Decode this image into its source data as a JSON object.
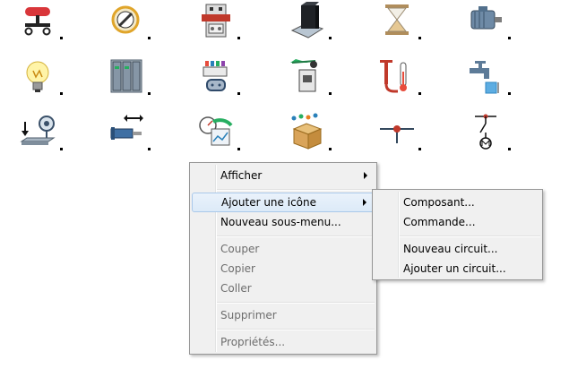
{
  "icons": [
    {
      "name": "red-button-icon"
    },
    {
      "name": "no-entry-icon"
    },
    {
      "name": "contactor-icon"
    },
    {
      "name": "ink-bottle-icon"
    },
    {
      "name": "hourglass-icon"
    },
    {
      "name": "motor-icon"
    },
    {
      "name": "light-bulb-icon"
    },
    {
      "name": "rack-panel-icon"
    },
    {
      "name": "terminal-block-icon"
    },
    {
      "name": "limit-switch-icon"
    },
    {
      "name": "pump-thermometer-icon"
    },
    {
      "name": "faucet-icon"
    },
    {
      "name": "pressure-sensor-icon"
    },
    {
      "name": "cylinder-icon"
    },
    {
      "name": "gauge-chart-icon"
    },
    {
      "name": "box-components-icon"
    },
    {
      "name": "pipe-junction-icon"
    },
    {
      "name": "motor-switch-icon"
    }
  ],
  "context_menu": {
    "items": [
      {
        "label": "Afficher"
      },
      {
        "label": "Ajouter une icône"
      },
      {
        "label": "Nouveau sous-menu..."
      },
      {
        "label": "Couper"
      },
      {
        "label": "Copier"
      },
      {
        "label": "Coller"
      },
      {
        "label": "Supprimer"
      },
      {
        "label": "Propriétés..."
      }
    ]
  },
  "submenu": {
    "items": [
      {
        "label": "Composant..."
      },
      {
        "label": "Commande..."
      },
      {
        "label": "Nouveau circuit..."
      },
      {
        "label": "Ajouter un circuit..."
      }
    ]
  }
}
